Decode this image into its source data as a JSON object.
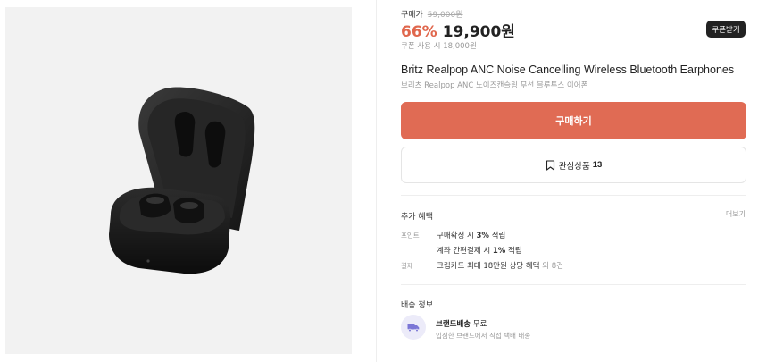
{
  "price": {
    "label": "구매가",
    "original": "59,000원",
    "discount": "66%",
    "sale": "19,900원",
    "coupon_note": "쿠폰 사용 시 18,000원",
    "coupon_button": "쿠폰받기"
  },
  "product": {
    "title": "Britz Realpop ANC Noise Cancelling Wireless Bluetooth Earphones",
    "subtitle": "브리츠 Realpop ANC 노이즈캔슬링 무선 블루투스 이어폰"
  },
  "actions": {
    "buy": "구매하기",
    "wishlist_label": "관심상품",
    "wishlist_count": "13"
  },
  "benefits": {
    "title": "추가 혜택",
    "more": "더보기",
    "point_key": "포인트",
    "point_line1_pre": "구매확정 시 ",
    "point_line1_bold": "3%",
    "point_line1_post": " 적립",
    "point_line2_pre": "계좌 간편결제 시 ",
    "point_line2_bold": "1%",
    "point_line2_post": " 적립",
    "pay_key": "결제",
    "pay_line": "크림카드 최대 18만원 상당 혜택",
    "pay_extra": "외 8건"
  },
  "shipping": {
    "title": "배송 정보",
    "type": "브랜드배송",
    "fee": "무료",
    "note": "입점한 브랜드에서 직접 택배 배송"
  },
  "colors": {
    "accent": "#e06b54",
    "discount": "#e0674d",
    "coupon_button": "#222222",
    "ship_icon_bg": "#ecebf9",
    "ship_icon": "#7b76d6"
  },
  "icons": {
    "wishlist": "bookmark-icon",
    "shipping": "truck-icon"
  }
}
